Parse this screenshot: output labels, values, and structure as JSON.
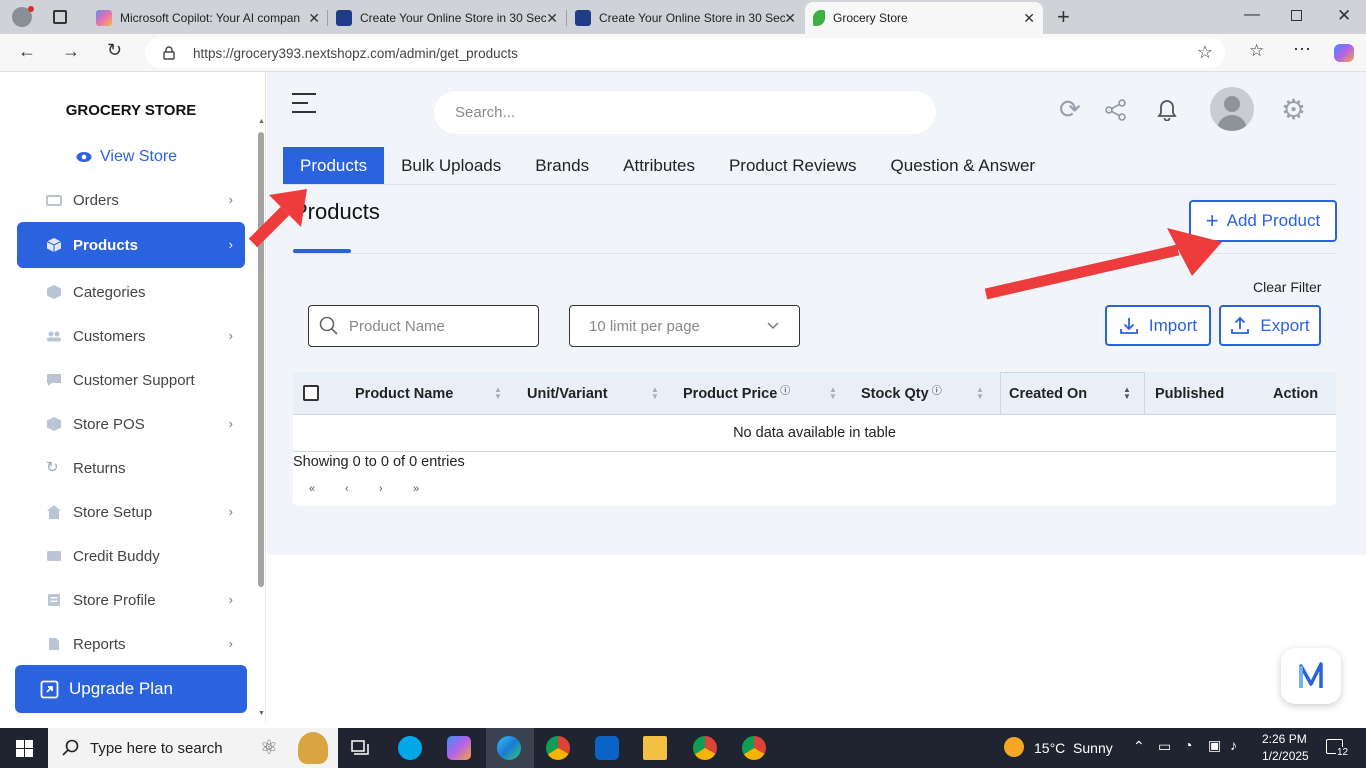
{
  "browser": {
    "tabs": [
      {
        "title": "Microsoft Copilot: Your AI compan",
        "favicon_color": "#5b8def"
      },
      {
        "title": "Create Your Online Store in 30 Sec",
        "favicon_color": "#1f3c88"
      },
      {
        "title": "Create Your Online Store in 30 Sec",
        "favicon_color": "#1f3c88"
      },
      {
        "title": "Grocery Store",
        "favicon_color": "#3cb043"
      }
    ],
    "url": "https://grocery393.nextshopz.com/admin/get_products"
  },
  "sidebar": {
    "store_name": "GROCERY STORE",
    "view_store": "View Store",
    "items": [
      {
        "label": "Orders",
        "icon": "orders-icon",
        "chevron": true
      },
      {
        "label": "Products",
        "icon": "box-icon",
        "chevron": true,
        "active": true
      },
      {
        "label": "Categories",
        "icon": "categories-icon",
        "chevron": false
      },
      {
        "label": "Customers",
        "icon": "users-icon",
        "chevron": true
      },
      {
        "label": "Customer Support",
        "icon": "chat-icon",
        "chevron": false
      },
      {
        "label": "Store POS",
        "icon": "pos-icon",
        "chevron": true
      },
      {
        "label": "Returns",
        "icon": "returns-icon",
        "chevron": false
      },
      {
        "label": "Store Setup",
        "icon": "home-icon",
        "chevron": true
      },
      {
        "label": "Credit Buddy",
        "icon": "credit-icon",
        "chevron": false
      },
      {
        "label": "Store Profile",
        "icon": "profile-icon",
        "chevron": true
      },
      {
        "label": "Reports",
        "icon": "reports-icon",
        "chevron": true
      }
    ],
    "upgrade_label": "Upgrade Plan"
  },
  "topbar": {
    "search_placeholder": "Search..."
  },
  "tabs": [
    "Products",
    "Bulk Uploads",
    "Brands",
    "Attributes",
    "Product Reviews",
    "Question & Answer"
  ],
  "page": {
    "title": "Products",
    "add_product": "Add Product",
    "clear_filter": "Clear Filter",
    "product_name_placeholder": "Product Name",
    "limit_value": "10 limit per page",
    "import_label": "Import",
    "export_label": "Export"
  },
  "table": {
    "columns": [
      "Product Name",
      "Unit/Variant",
      "Product Price",
      "Stock Qty",
      "Created On",
      "Published",
      "Action"
    ],
    "empty_message": "No data available in table",
    "showing": "Showing 0 to 0 of 0 entries",
    "pager": [
      "«",
      "‹",
      "›",
      "»"
    ]
  },
  "taskbar": {
    "search_placeholder": "Type here to search",
    "weather": "15°C  Sunny",
    "time": "2:26 PM",
    "date": "1/2/2025",
    "notifications": "12"
  },
  "colors": {
    "accent": "#2b62de",
    "arrow": "#ee3b3b"
  }
}
